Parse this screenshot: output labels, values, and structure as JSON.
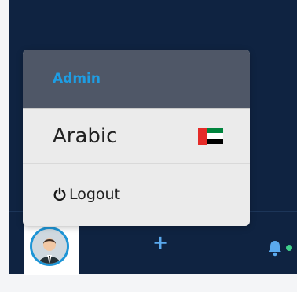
{
  "menu": {
    "header_label": "Admin",
    "language_label": "Arabic",
    "language_flag": "uae-flag-icon",
    "logout_label": "Logout",
    "logout_icon": "power-icon"
  },
  "toolbar": {
    "avatar": "user-avatar",
    "add_icon": "plus-icon",
    "notification_icon": "bell-icon"
  },
  "colors": {
    "background": "#0f2341",
    "header_bg": "#4f5767",
    "accent": "#1e9de3",
    "menu_bg": "#ebebeb",
    "status_dot": "#3fd08a"
  }
}
